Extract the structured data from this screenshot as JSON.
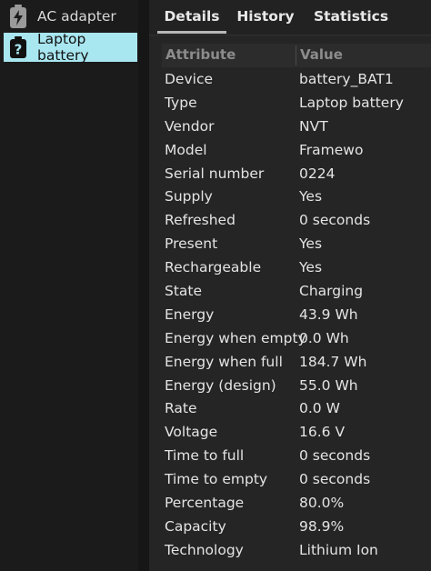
{
  "sidebar": {
    "items": [
      {
        "label": "AC adapter",
        "icon": "bolt-icon"
      },
      {
        "label": "Laptop battery",
        "icon": "question-icon"
      }
    ]
  },
  "tabs": [
    {
      "label": "Details"
    },
    {
      "label": "History"
    },
    {
      "label": "Statistics"
    }
  ],
  "table": {
    "headers": {
      "attribute": "Attribute",
      "value": "Value"
    },
    "rows": [
      {
        "attribute": "Device",
        "value": "battery_BAT1"
      },
      {
        "attribute": "Type",
        "value": "Laptop battery"
      },
      {
        "attribute": "Vendor",
        "value": "NVT"
      },
      {
        "attribute": "Model",
        "value": "Framewo"
      },
      {
        "attribute": "Serial number",
        "value": "0224"
      },
      {
        "attribute": "Supply",
        "value": "Yes"
      },
      {
        "attribute": "Refreshed",
        "value": "0 seconds"
      },
      {
        "attribute": "Present",
        "value": "Yes"
      },
      {
        "attribute": "Rechargeable",
        "value": "Yes"
      },
      {
        "attribute": "State",
        "value": "Charging"
      },
      {
        "attribute": "Energy",
        "value": "43.9 Wh"
      },
      {
        "attribute": "Energy when empty",
        "value": "0.0 Wh"
      },
      {
        "attribute": "Energy when full",
        "value": "184.7 Wh"
      },
      {
        "attribute": "Energy (design)",
        "value": "55.0 Wh"
      },
      {
        "attribute": "Rate",
        "value": "0.0 W"
      },
      {
        "attribute": "Voltage",
        "value": "16.6 V"
      },
      {
        "attribute": "Time to full",
        "value": "0 seconds"
      },
      {
        "attribute": "Time to empty",
        "value": "0 seconds"
      },
      {
        "attribute": "Percentage",
        "value": "80.0%"
      },
      {
        "attribute": "Capacity",
        "value": "98.9%"
      },
      {
        "attribute": "Technology",
        "value": "Lithium Ion"
      }
    ]
  },
  "colors": {
    "selected_bg": "#a8e6f0",
    "background": "#252525",
    "sidebar_bg": "#1b1b1b"
  }
}
